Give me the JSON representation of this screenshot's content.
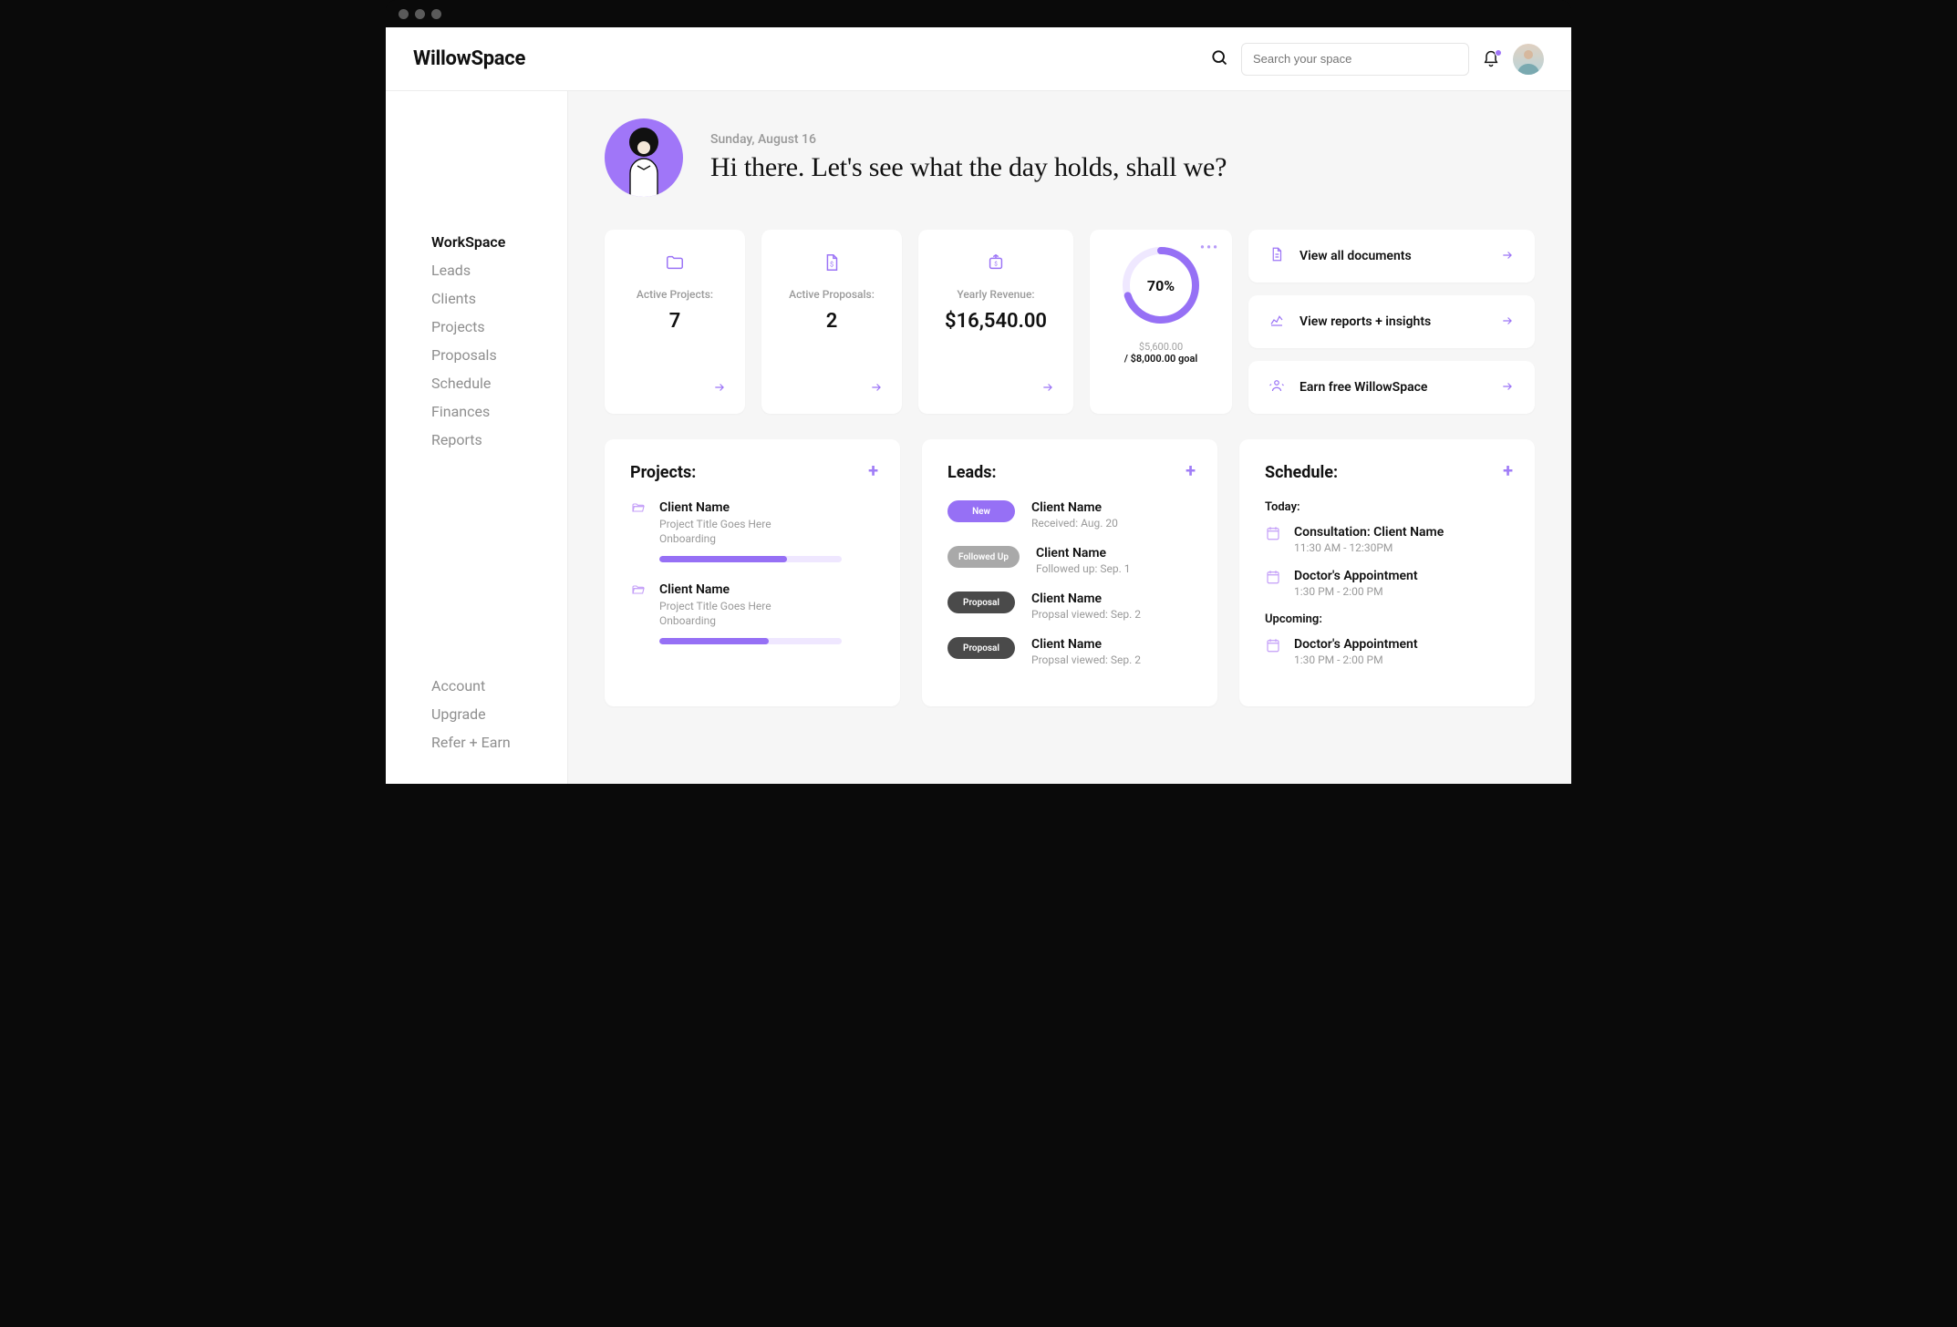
{
  "brand": "WillowSpace",
  "search": {
    "placeholder": "Search your space"
  },
  "sidebar": {
    "main": [
      "WorkSpace",
      "Leads",
      "Clients",
      "Projects",
      "Proposals",
      "Schedule",
      "Finances",
      "Reports"
    ],
    "activeIndex": 0,
    "bottom": [
      "Account",
      "Upgrade",
      "Refer + Earn"
    ]
  },
  "greeting": {
    "date": "Sunday, August 16",
    "headline": "Hi there. Let's see what the day holds, shall we?"
  },
  "stats": {
    "activeProjects": {
      "label": "Active Projects:",
      "value": "7"
    },
    "activeProposals": {
      "label": "Active Proposals:",
      "value": "2"
    },
    "yearlyRevenue": {
      "label": "Yearly Revenue:",
      "value": "$16,540.00"
    },
    "goal": {
      "percent": "70%",
      "percentNum": 70,
      "current": "$5,600.00",
      "target": "/ $8,000.00 goal"
    }
  },
  "actions": [
    {
      "label": "View all documents"
    },
    {
      "label": "View reports + insights"
    },
    {
      "label": "Earn free WillowSpace"
    }
  ],
  "projects": {
    "title": "Projects:",
    "items": [
      {
        "client": "Client Name",
        "title": "Project Title Goes Here",
        "status": "Onboarding",
        "progress": 70
      },
      {
        "client": "Client Name",
        "title": "Project Title Goes Here",
        "status": "Onboarding",
        "progress": 60
      }
    ]
  },
  "leads": {
    "title": "Leads:",
    "items": [
      {
        "pill": "New",
        "pillClass": "pill-new",
        "client": "Client Name",
        "meta": "Received: Aug. 20"
      },
      {
        "pill": "Followed Up",
        "pillClass": "pill-followed",
        "client": "Client Name",
        "meta": "Followed up: Sep. 1"
      },
      {
        "pill": "Proposal",
        "pillClass": "pill-proposal",
        "client": "Client Name",
        "meta": "Propsal viewed: Sep. 2"
      },
      {
        "pill": "Proposal",
        "pillClass": "pill-proposal",
        "client": "Client Name",
        "meta": "Propsal viewed: Sep. 2"
      }
    ]
  },
  "schedule": {
    "title": "Schedule:",
    "today_label": "Today:",
    "upcoming_label": "Upcoming:",
    "today": [
      {
        "title": "Consultation: Client Name",
        "time": "11:30 AM - 12:30PM"
      },
      {
        "title": "Doctor's Appointment",
        "time": "1:30 PM - 2:00 PM"
      }
    ],
    "upcoming": [
      {
        "title": "Doctor's Appointment",
        "time": "1:30 PM - 2:00 PM"
      }
    ]
  }
}
